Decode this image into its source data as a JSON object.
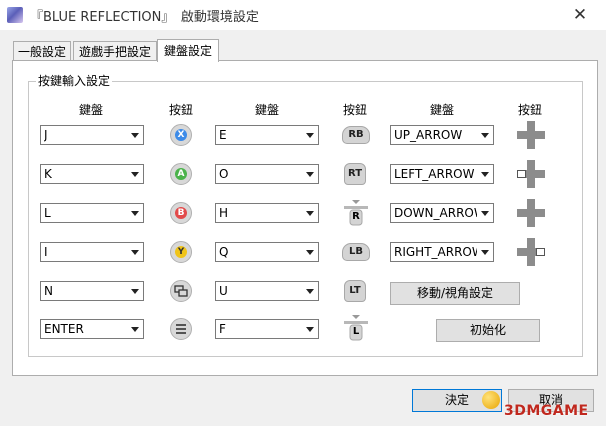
{
  "window": {
    "title": "『BLUE REFLECTION』　啟動環境設定",
    "close_glyph": "✕"
  },
  "tabs": [
    {
      "label": "一般設定",
      "active": false
    },
    {
      "label": "遊戲手把設定",
      "active": false
    },
    {
      "label": "鍵盤設定",
      "active": true
    }
  ],
  "group": {
    "title": "按鍵輸入設定",
    "headers": {
      "keyboard": "鍵盤",
      "button": "按鈕"
    }
  },
  "col1": [
    {
      "key": "J",
      "button": "X",
      "icon": "x-button-icon",
      "color": "#3d8be8"
    },
    {
      "key": "K",
      "button": "A",
      "icon": "a-button-icon",
      "color": "#4bb34b"
    },
    {
      "key": "L",
      "button": "B",
      "icon": "b-button-icon",
      "color": "#e24a4a"
    },
    {
      "key": "I",
      "button": "Y",
      "icon": "y-button-icon",
      "color": "#f0c419"
    },
    {
      "key": "N",
      "button": "",
      "icon": "view-button-icon"
    },
    {
      "key": "ENTER",
      "button": "",
      "icon": "menu-button-icon"
    }
  ],
  "col2": [
    {
      "key": "E",
      "button": "RB",
      "icon": "rb-button-icon"
    },
    {
      "key": "O",
      "button": "RT",
      "icon": "rt-trigger-icon"
    },
    {
      "key": "H",
      "button": "R",
      "icon": "right-stick-icon"
    },
    {
      "key": "Q",
      "button": "LB",
      "icon": "lb-button-icon"
    },
    {
      "key": "U",
      "button": "LT",
      "icon": "lt-trigger-icon"
    },
    {
      "key": "F",
      "button": "L",
      "icon": "left-stick-icon"
    }
  ],
  "col3": [
    {
      "key": "UP_ARROW",
      "icon": "dpad-up-icon"
    },
    {
      "key": "LEFT_ARROW",
      "icon": "dpad-left-icon"
    },
    {
      "key": "DOWN_ARROW",
      "icon": "dpad-down-icon"
    },
    {
      "key": "RIGHT_ARROW",
      "icon": "dpad-right-icon"
    }
  ],
  "buttons": {
    "move_view": "移動/視角設定",
    "reset": "初始化",
    "ok": "決定",
    "cancel": "取消"
  },
  "watermark": "3DMGAME"
}
